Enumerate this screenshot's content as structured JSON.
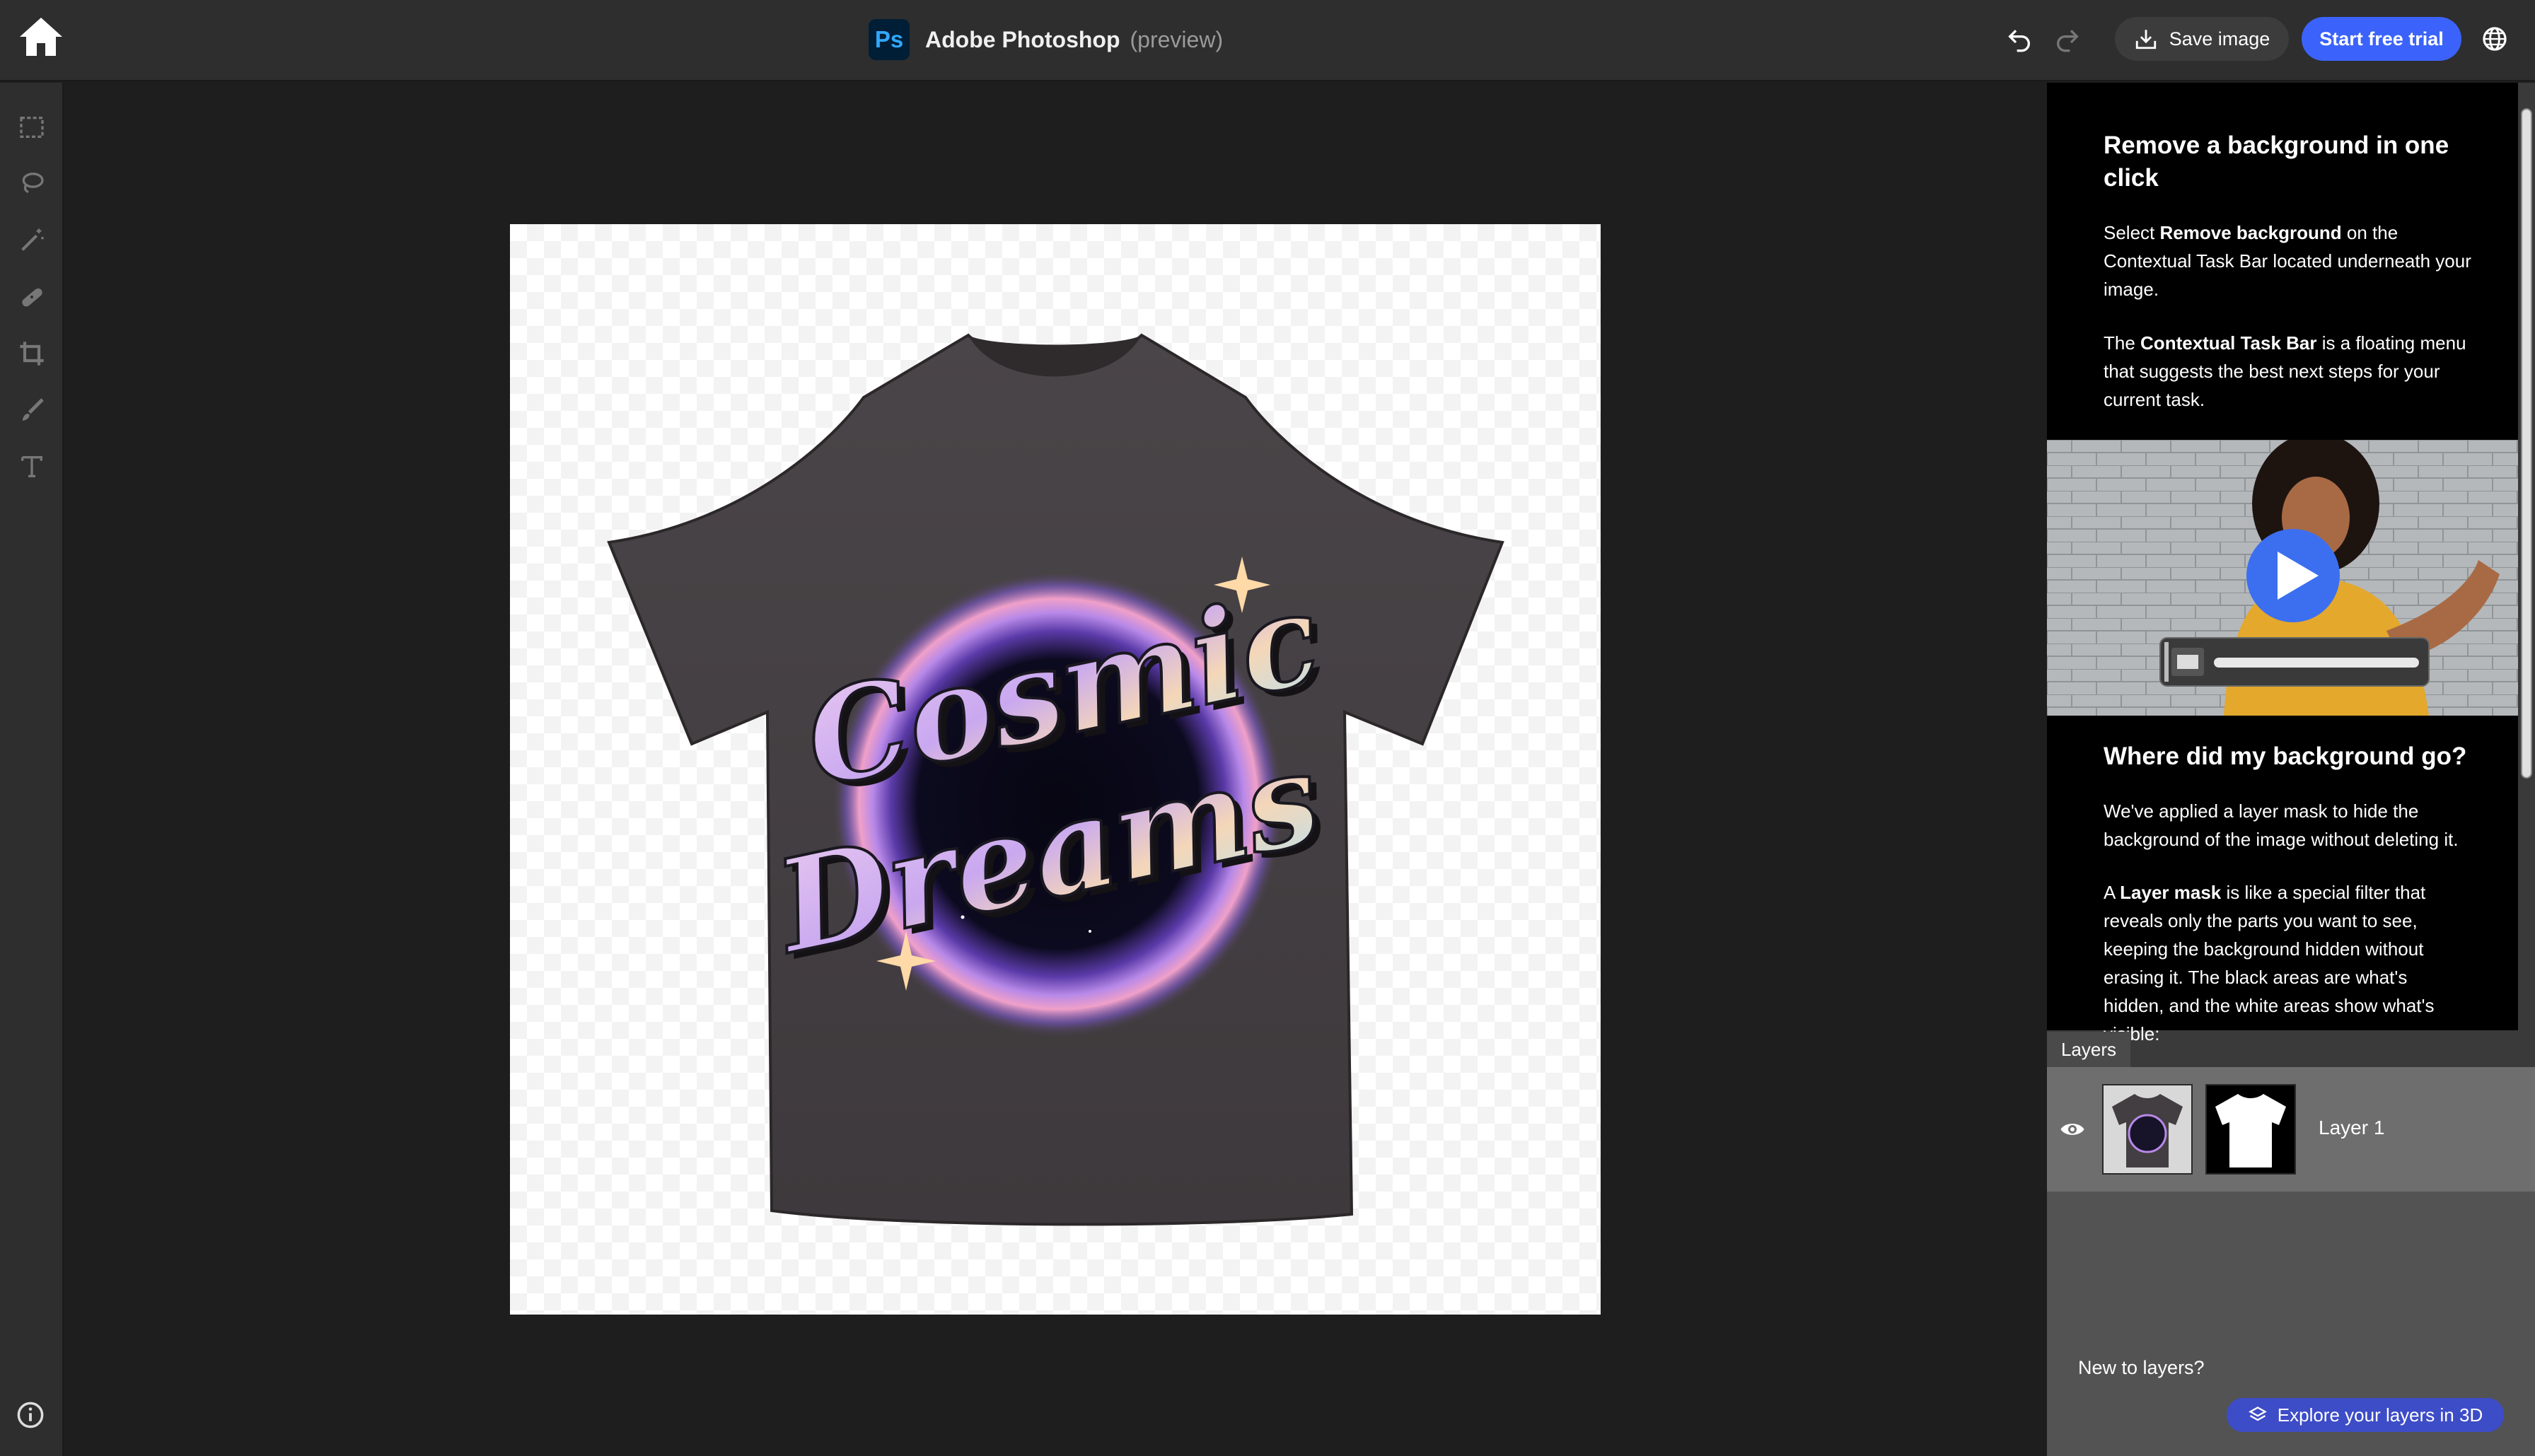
{
  "app": {
    "name": "Adobe Photoshop",
    "subtitle": "(preview)",
    "logo_text": "Ps",
    "colors": {
      "accent": "#3b63fb",
      "ps_blue": "#31a8ff",
      "ps_dark": "#001e36"
    }
  },
  "toolbar": {
    "save_label": "Save image",
    "trial_label": "Start free trial",
    "icons": [
      "home-icon",
      "undo-icon",
      "redo-icon",
      "download-icon",
      "globe-icon"
    ]
  },
  "tools": [
    "marquee-icon",
    "lasso-icon",
    "magic-wand-icon",
    "healing-brush-icon",
    "crop-icon",
    "brush-icon",
    "text-icon"
  ],
  "canvas": {
    "shirt_line1": "Cosmic",
    "shirt_line2": "Dreams"
  },
  "help": {
    "title1": "Remove a background in one click",
    "p1_prefix": "Select ",
    "p1_bold": "Remove background",
    "p1_suffix": " on the Contextual Task Bar located underneath your image.",
    "p2_prefix": "The ",
    "p2_bold": "Contextual Task Bar",
    "p2_suffix": " is a floating menu that suggests the best next steps for your current task.",
    "title2": "Where did my background go?",
    "p3": "We've applied a layer mask to hide the background of the image without deleting it.",
    "p4_prefix": "A ",
    "p4_bold": "Layer mask",
    "p4_suffix": " is like a special filter that reveals only the parts you want to see, keeping the background hidden without erasing it. The black areas are what's hidden, and the white areas show what's visible:"
  },
  "layers": {
    "tab_label": "Layers",
    "items": [
      {
        "name": "Layer 1"
      }
    ],
    "new_prompt": "New to layers?",
    "explore_label": "Explore your layers in 3D"
  }
}
